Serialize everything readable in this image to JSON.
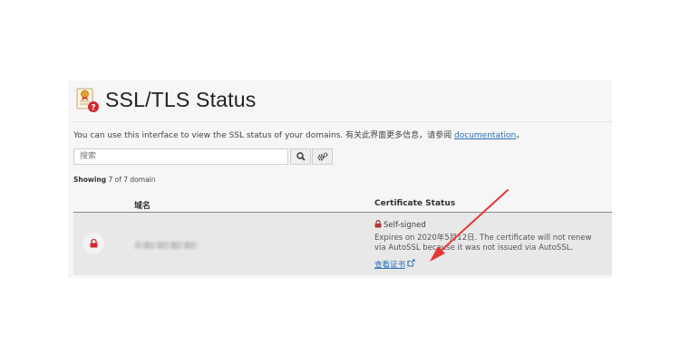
{
  "page": {
    "title": "SSL/TLS Status",
    "intro_text": "You can use this interface to view the SSL status of your domains. 有关此界面更多信息，请参阅 ",
    "intro_link": "documentation",
    "intro_end": "。"
  },
  "search": {
    "placeholder": "搜索"
  },
  "listing": {
    "showing_label": "Showing",
    "showing_text": " 7 of 7 domain"
  },
  "table": {
    "columns": [
      "域名",
      "Certificate Status"
    ],
    "rows": [
      {
        "status": "Self-signed",
        "expires": "Expires on 2020年5月12日. The certificate will not renew via AutoSSL because it was not issued via AutoSSL.",
        "link": "查看证书"
      }
    ]
  },
  "colors": {
    "accent_link": "#2a6ebb",
    "lock_red": "#d0282e",
    "annotation_arrow": "#e53935"
  }
}
